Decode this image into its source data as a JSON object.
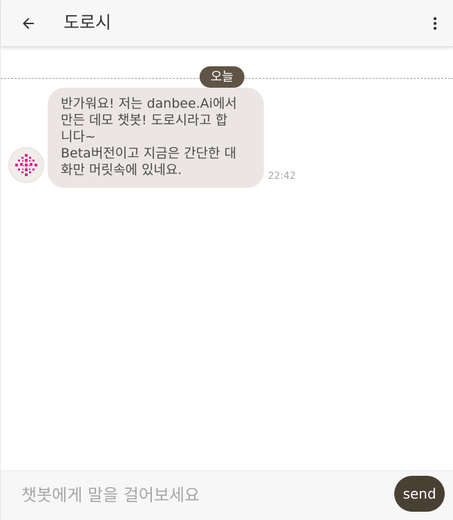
{
  "header": {
    "back_icon": "arrow-left-icon",
    "title": "도로시",
    "menu_icon": "more-vertical-icon"
  },
  "chat": {
    "date_label": "오늘",
    "messages": [
      {
        "sender": "bot",
        "avatar_icon": "bot-avatar-icon",
        "lines": [
          "반가워요! 저는 danbee.Ai에서",
          "만든 데모 챗봇! 도로시라고 합",
          "니다~",
          "Beta버전이고 지금은 간단한 대",
          "화만 머릿속에 있네요."
        ],
        "time": "22:42"
      }
    ]
  },
  "input": {
    "placeholder": "챗봇에게 말을 걸어보세요",
    "value": "",
    "send_label": "send"
  },
  "colors": {
    "header_bg": "#f7f7f7",
    "date_badge_bg": "#5f5446",
    "bubble_bg": "#ebe6e3",
    "send_bg": "#4a3f33",
    "avatar_pattern": "#e0218a"
  }
}
